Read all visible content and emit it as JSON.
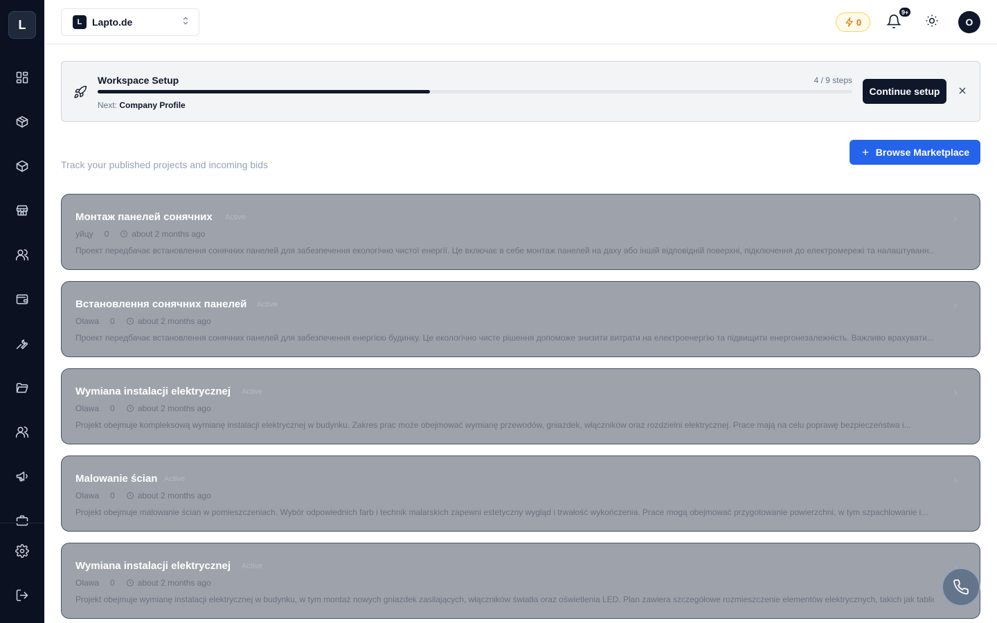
{
  "sidebar": {
    "logo": "L",
    "items": [
      {
        "icon": "dashboard-icon"
      },
      {
        "icon": "package-icon"
      },
      {
        "icon": "box-icon"
      },
      {
        "icon": "store-icon"
      },
      {
        "icon": "users-icon"
      },
      {
        "icon": "wallet-icon"
      },
      {
        "icon": "wrench-icon"
      },
      {
        "icon": "folder-open-icon"
      },
      {
        "icon": "team-icon"
      },
      {
        "icon": "megaphone-icon"
      },
      {
        "icon": "briefcase-icon"
      }
    ],
    "bottom": [
      {
        "icon": "settings-icon"
      },
      {
        "icon": "logout-icon"
      }
    ]
  },
  "header": {
    "workspace": {
      "badge": "L",
      "name": "Lapto.de"
    },
    "credits": "0",
    "notifications_badge": "9+",
    "avatar_initial": "O"
  },
  "setup": {
    "title": "Workspace Setup",
    "steps": "4 / 9 steps",
    "progress": 0.44,
    "next_label": "Next:",
    "next_step": "Company Profile",
    "button": "Continue setup"
  },
  "page": {
    "subtitle": "Track your published projects and incoming bids",
    "browse_button": "Browse Marketplace"
  },
  "projects": [
    {
      "title": "Монтаж панелей сонячних",
      "status": "Active",
      "location": "уйцу",
      "bids": "0",
      "time": "about 2 months ago",
      "description": "Проект передбачає встановлення сонячних панелей для забезпечення екологічно чистої енергії. Це включає в себе монтаж панелей на даху або іншій відповідній поверхні, підключення до електромережі та налаштуванн..."
    },
    {
      "title": "Встановлення сонячних панелей",
      "status": "Active",
      "location": "Olawa",
      "bids": "0",
      "time": "about 2 months ago",
      "description": "Проект передбачає встановлення сонячних панелей для забезпечення енергією будинку. Це екологічно чисте рішення допоможе знизити витрати на електроенергію та підвищити енергонезалежність. Важливо врахувати..."
    },
    {
      "title": "Wymiana instalacji elektrycznej",
      "status": "Active",
      "location": "Olawa",
      "bids": "0",
      "time": "about 2 months ago",
      "description": "Projekt obejmuje kompleksową wymianę instalacji elektrycznej w budynku. Zakres prac może obejmować wymianę przewodów, gniazdek, włączników oraz rozdzielni elektrycznej. Prace mają na celu poprawę bezpieczeństwa i..."
    },
    {
      "title": "Malowanie ścian",
      "status": "Active",
      "location": "Olawa",
      "bids": "0",
      "time": "about 2 months ago",
      "description": "Projekt obejmuje malowanie ścian w pomieszczeniach. Wybór odpowiednich farb i technik malarskich zapewni estetyczny wygląd i trwałość wykończenia. Prace mogą obejmować przygotowanie powierzchni, w tym szpachlowanie i..."
    },
    {
      "title": "Wymiana instalacji elektrycznej",
      "status": "Active",
      "location": "Olawa",
      "bids": "0",
      "time": "about 2 months ago",
      "description": "Projekt obejmuje wymianę instalacji elektrycznej w budynku, w tym montaż nowych gniazdek zasilających, włączników światła oraz oświetlenia LED. Plan zawiera szczegółowe rozmieszczenie elementów elektrycznych, takich jak tablice..."
    }
  ],
  "colors": {
    "sidebar": "#0b1120",
    "primary": "#0f172a",
    "accent": "#2563eb",
    "credits": "#d97706",
    "card_overlay": "#9ea2ab"
  }
}
